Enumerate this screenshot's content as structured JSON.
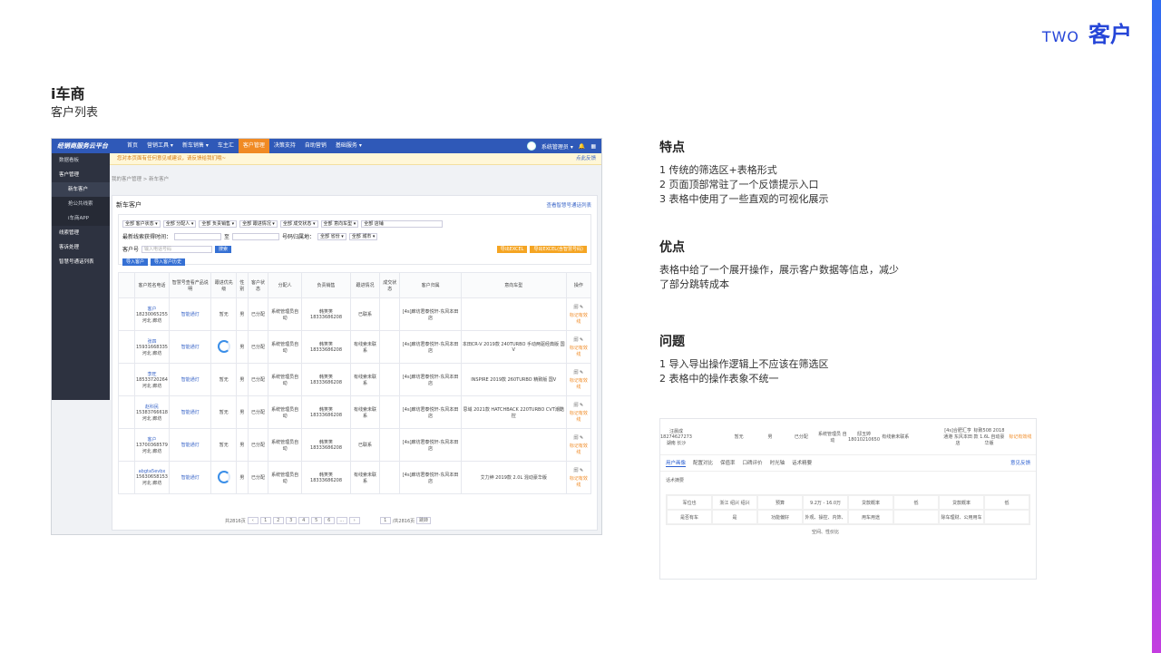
{
  "header": {
    "two": "TWO",
    "section": "客户"
  },
  "title": "i车商",
  "subtitle": "客户列表",
  "app": {
    "logo": "经销商服务云平台",
    "nav": [
      "首页",
      "营销工具 ▾",
      "新车销售 ▾",
      "车主汇",
      "客户管理",
      "决策支持",
      "自助营销",
      "基础服务 ▾"
    ],
    "user": "系统管理员 ▾",
    "sidebar": [
      "数据看板",
      "客户管理",
      "新车客户",
      "抢公共线索",
      "i车商APP",
      "线索管理",
      "客诉处理",
      "智慧号通话列表"
    ],
    "notice": "您对本页面有任何意见或建议，请反馈给我们哦~",
    "notice_link": "点此反馈",
    "breadcrumb": "我的客户管理 > 新车客户",
    "panel_title": "新车客户",
    "panel_link": "查看智慧号通话列表",
    "filters": {
      "row1": [
        "全部 客户状态 ▾",
        "全部 分配人 ▾",
        "全部 负责销售 ▾",
        "全部 跟进情况 ▾",
        "全部 成交状态 ▾",
        "全部 意向车型 ▾",
        "全部 店铺"
      ],
      "row2_label": "最新线索获得时间：",
      "row2_to": "至",
      "row2_region": "号码归属地：",
      "row2_selects": [
        "全部 省份 ▾",
        "全部 城市 ▾"
      ],
      "row3_label": "客户号",
      "row3_placeholder": "输入电话号码",
      "search": "搜索",
      "import": "导入客户",
      "history": "导入客户历史",
      "export": "导出EXCEL",
      "export2": "导出EXCEL(含智慧号码)"
    },
    "columns": [
      "客户姓名电话",
      "智慧号查看产品说明",
      "跟进优先级",
      "性别",
      "客户状态",
      "分配人",
      "负责销售",
      "跟进情况",
      "成交状态",
      "客户归属",
      "意向车型",
      "操作"
    ],
    "rows": [
      {
        "name": "客户",
        "phone": "18230065255",
        "loc": "河北 廊坊",
        "smart": "智能通灯",
        "prio": "暂无",
        "sex": "男",
        "status": "已分配",
        "assign": "系统管理员自动",
        "sales": "韩笑笑 18333686208",
        "follow": "已联系",
        "deal": "",
        "owner": "[4s]廊坊君泰悦轩-东风本田店",
        "model": "",
        "ring": false
      },
      {
        "name": "张四",
        "phone": "15931668335",
        "loc": "河北 廊坊",
        "smart": "智能通灯",
        "prio": "",
        "sex": "男",
        "status": "已分配",
        "assign": "系统管理员自动",
        "sales": "韩笑笑 18333686208",
        "follow": "有线索未联系",
        "deal": "",
        "owner": "[4s]廊坊君泰悦轩-东风本田店",
        "model": "本田CR-V 2019款 240TURBO 手动两驱经典版 国V",
        "ring": true
      },
      {
        "name": "李旺",
        "phone": "18533720264",
        "loc": "河北 廊坊",
        "smart": "智能通灯",
        "prio": "暂无",
        "sex": "男",
        "status": "已分配",
        "assign": "系统管理员自动",
        "sales": "韩笑笑 18333686208",
        "follow": "有线索未联系",
        "deal": "",
        "owner": "[4s]廊坊君泰悦轩-东风本田店",
        "model": "INSPIRE 2019款 260TURBO 精致版 国V",
        "ring": false
      },
      {
        "name": "赵科民",
        "phone": "15383766618",
        "loc": "河北 廊坊",
        "smart": "智能通灯",
        "prio": "暂无",
        "sex": "男",
        "status": "已分配",
        "assign": "系统管理员自动",
        "sales": "韩笑笑 18333686208",
        "follow": "有线索未联系",
        "deal": "",
        "owner": "[4s]廊坊君泰悦轩-东风本田店",
        "model": "思域 2021款 HATCHBACK 220TURBO CVT潮酷控",
        "ring": false
      },
      {
        "name": "客户",
        "phone": "13700368579",
        "loc": "河北 廊坊",
        "smart": "智能通灯",
        "prio": "暂无",
        "sex": "男",
        "status": "已分配",
        "assign": "系统管理员自动",
        "sales": "韩笑笑 18333686208",
        "follow": "已联系",
        "deal": "",
        "owner": "[4s]廊坊君泰悦轩-东风本田店",
        "model": "",
        "ring": false
      },
      {
        "name": "abgta5evbx",
        "phone": "15630658153",
        "loc": "河北 廊坊",
        "smart": "智能通灯",
        "prio": "",
        "sex": "男",
        "status": "已分配",
        "assign": "系统管理员自动",
        "sales": "韩笑笑 18333686208",
        "follow": "有线索未联系",
        "deal": "",
        "owner": "[4s]廊坊君泰悦轩-东风本田店",
        "model": "艾力绅 2019款 2.0L 混动豪华版",
        "ring": true
      }
    ],
    "op_label": "标记有效线",
    "pager": {
      "total": "共2816页",
      "pages": [
        "‹",
        "1",
        "2",
        "3",
        "4",
        "5",
        "6",
        "...",
        "›"
      ],
      "jump_label": "/共2816页",
      "jump": "跳转",
      "input": "1"
    }
  },
  "features": {
    "h": "特点",
    "items": [
      "1 传统的筛选区+表格形式",
      "2 页面顶部常驻了一个反馈提示入口",
      "3 表格中使用了一些直观的可视化展示"
    ]
  },
  "pros": {
    "h": "优点",
    "text": "表格中给了一个展开操作，展示客户数据等信息，减少了部分跳转成本"
  },
  "issues": {
    "h": "问题",
    "items": [
      "1 导入导出操作逻辑上不应该在筛选区",
      "2 表格中的操作表象不统一"
    ]
  },
  "shot2": {
    "row": [
      "汪晨成 18274627273 湖南 长沙",
      "",
      "暂无",
      "男",
      "已分配",
      "系统管理员 自动",
      "邸玉婷 18010210650",
      "有线索未联系",
      "",
      "[4s]合肥汇亨通港 东风本田店",
      "标致508 2018款 1.6L 自动豪华版",
      "标记有效线"
    ],
    "tabs": [
      "用户画像",
      "配置对比",
      "保值率",
      "口碑评价",
      "时光轴",
      "话术精要"
    ],
    "tab_link": "意见反馈",
    "body_title": "话术摘要",
    "grid": [
      "军位也",
      "浙江 绍兴 绍兴",
      "预算",
      "9.2万 - 16.0万",
      "贷款概率",
      "低",
      "贷款概率",
      "低",
      "是否有车",
      "是",
      "功能偏好",
      "外观、操控、内饰、空间、性价比",
      "用车用途",
      "",
      "除车理财、公用用车",
      ""
    ]
  }
}
